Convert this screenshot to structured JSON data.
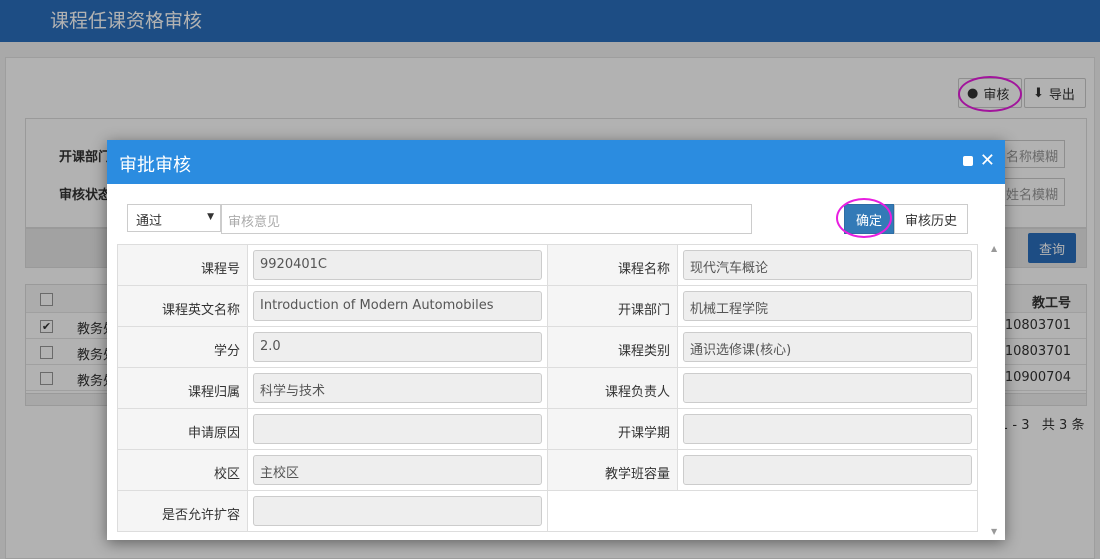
{
  "page_title": "课程任课资格审核",
  "toolbar": {
    "audit_label": "审核",
    "export_label": "导出"
  },
  "filter": {
    "dept_label": "开课部门",
    "status_label": "审核状态",
    "course_name_placeholder": "名称模糊",
    "teacher_name_placeholder": "姓名模糊",
    "query_label": "查询"
  },
  "grid": {
    "header_last": "教工号",
    "rows": [
      {
        "checked": true,
        "col1": "教务处",
        "teacher_id": "10803701"
      },
      {
        "checked": false,
        "col1": "教务处",
        "teacher_id": "10803701"
      },
      {
        "checked": false,
        "col1": "教务处",
        "teacher_id": "10900704"
      }
    ]
  },
  "pager": {
    "range": "1 - 3",
    "total": "共 3 条"
  },
  "modal": {
    "title": "审批审核",
    "result_select": "通过",
    "opinion_placeholder": "审核意见",
    "confirm_label": "确定",
    "history_label": "审核历史",
    "fields": {
      "course_no_label": "课程号",
      "course_no": "9920401C",
      "course_name_label": "课程名称",
      "course_name": "现代汽车概论",
      "course_en_label": "课程英文名称",
      "course_en": "Introduction of Modern Automobiles",
      "dept_label": "开课部门",
      "dept": "机械工程学院",
      "credit_label": "学分",
      "credit": "2.0",
      "category_label": "课程类别",
      "category": "通识选修课(核心)",
      "belong_label": "课程归属",
      "belong": "科学与技术",
      "owner_label": "课程负责人",
      "owner": "",
      "reason_label": "申请原因",
      "reason": "",
      "term_label": "开课学期",
      "term": "",
      "campus_label": "校区",
      "campus": "主校区",
      "capacity_label": "教学班容量",
      "capacity": "",
      "expand_label": "是否允许扩容",
      "expand": ""
    }
  },
  "colors": {
    "header": "#2a6fbd",
    "modal_header": "#2b8ce0",
    "primary_button": "#337ab7",
    "highlight_circle": "#e81ee0"
  }
}
